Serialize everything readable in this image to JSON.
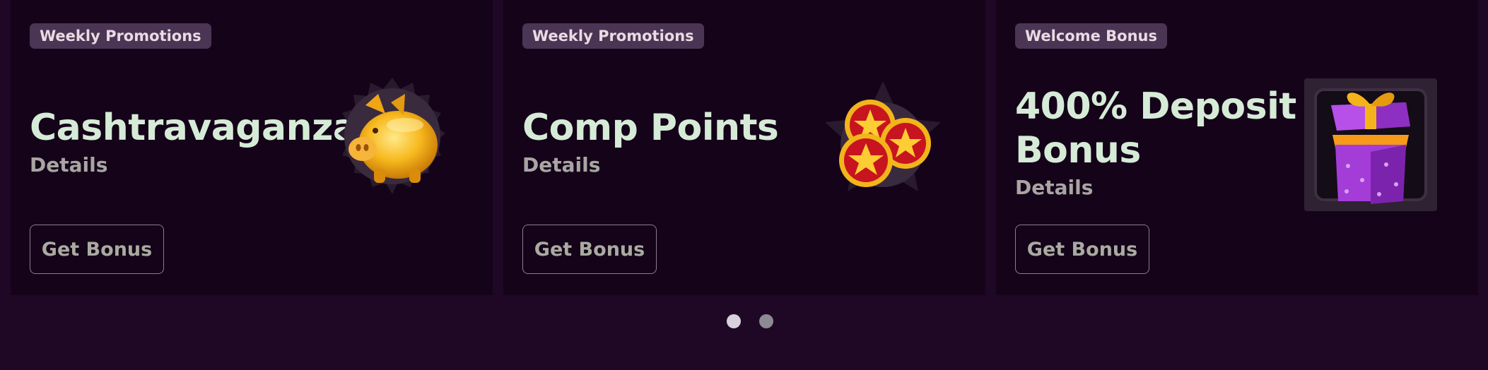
{
  "promotions": [
    {
      "badge": "Weekly Promotions",
      "title": "Cashtravaganza",
      "details": "Details",
      "button": "Get Bonus",
      "icon": "piggy-bank-icon"
    },
    {
      "badge": "Weekly Promotions",
      "title": "Comp Points",
      "details": "Details",
      "button": "Get Bonus",
      "icon": "star-coins-icon"
    },
    {
      "badge": "Welcome Bonus",
      "title": "400% Deposit Bonus",
      "details": "Details",
      "button": "Get Bonus",
      "icon": "gift-box-icon"
    }
  ],
  "pagination": {
    "pages": 2,
    "active": 1
  },
  "colors": {
    "page_background": "#1f0826",
    "card_background": "#150419",
    "badge_background": "#4b3554",
    "title_text": "#d6ebd7",
    "details_text": "#a8a5a3",
    "button_border": "#8a7c8c",
    "dot_active": "#d8d2dc",
    "dot_inactive": "#8d8a93"
  }
}
